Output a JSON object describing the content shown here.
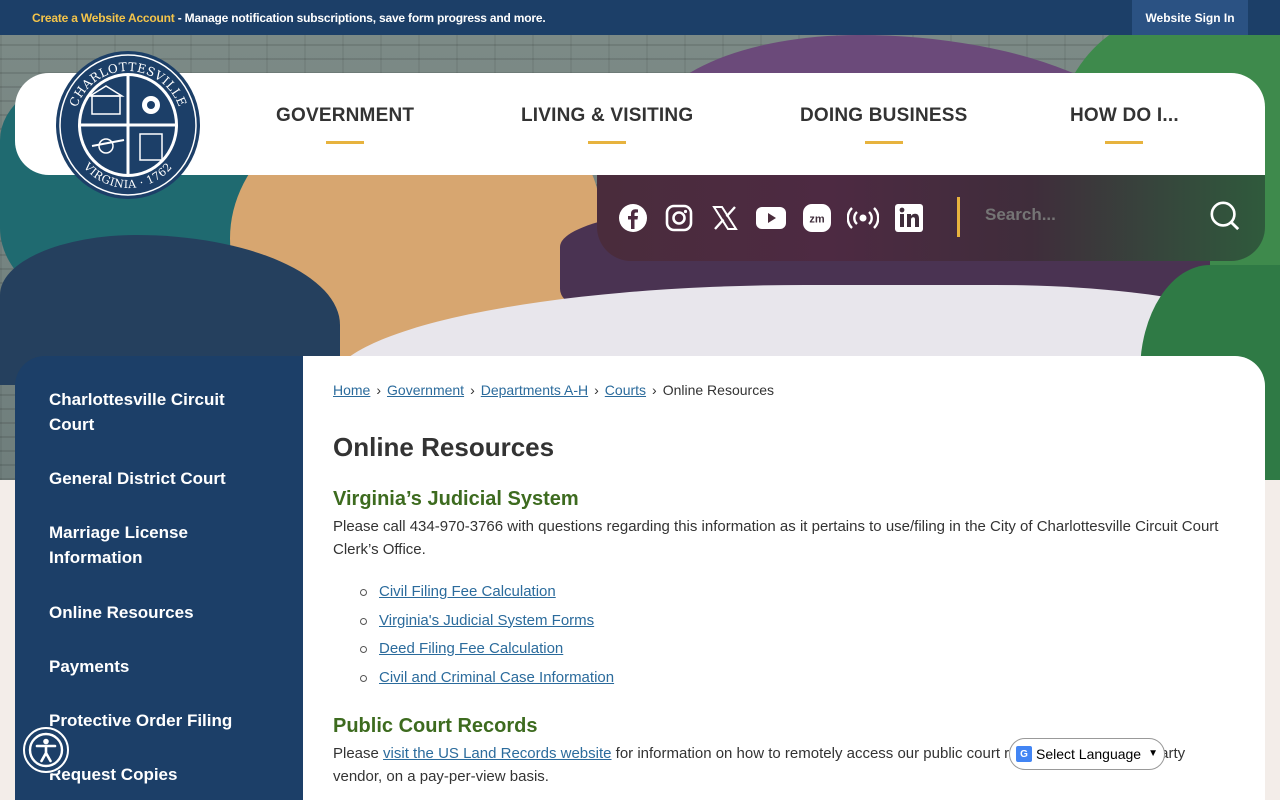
{
  "topbar": {
    "create_link": "Create a Website Account",
    "message": " - Manage notification subscriptions, save form progress and more.",
    "signin": "Website Sign In"
  },
  "seal": {
    "top_text": "CHARLOTTESVILLE",
    "bottom_text": "VIRGINIA · 1762"
  },
  "nav": {
    "items": [
      {
        "label": "GOVERNMENT"
      },
      {
        "label": "LIVING & VISITING"
      },
      {
        "label": "DOING BUSINESS"
      },
      {
        "label": "HOW DO I..."
      }
    ]
  },
  "social": {
    "icons": [
      "facebook-icon",
      "instagram-icon",
      "x-icon",
      "youtube-icon",
      "zoom-icon",
      "podcast-icon",
      "linkedin-icon"
    ],
    "search_placeholder": "Search..."
  },
  "sidebar": {
    "items": [
      {
        "label": "Charlottesville Circuit Court"
      },
      {
        "label": "General District Court"
      },
      {
        "label": "Marriage License Information"
      },
      {
        "label": "Online Resources"
      },
      {
        "label": "Payments"
      },
      {
        "label": "Protective Order Filing"
      },
      {
        "label": "Request Copies"
      }
    ]
  },
  "breadcrumb": {
    "items": [
      "Home",
      "Government",
      "Departments A-H",
      "Courts"
    ],
    "current": "Online Resources"
  },
  "content": {
    "title": "Online Resources",
    "section1": {
      "heading": "Virginia’s Judicial System",
      "text": "Please call 434-970-3766 with questions regarding this information as it pertains to use/filing in the City of Charlottesville Circuit Court Clerk’s Office.",
      "links": [
        "Civil Filing Fee Calculation",
        "Virginia's Judicial System Forms",
        "Deed Filing Fee Calculation",
        "Civil and Criminal Case Information"
      ]
    },
    "section2": {
      "heading": "Public Court Records",
      "text_before": "Please ",
      "link": "visit the US Land Records website",
      "text_after": " for information on how to remotely access our public court records through a 3rd party vendor, on a pay-per-view basis."
    }
  },
  "widgets": {
    "language": "Select Language",
    "translate_badge": "G"
  },
  "colors": {
    "navy": "#1c3f68",
    "gold": "#e7b33e",
    "link": "#2b6b9c",
    "heading_green": "#3d6b1f"
  }
}
